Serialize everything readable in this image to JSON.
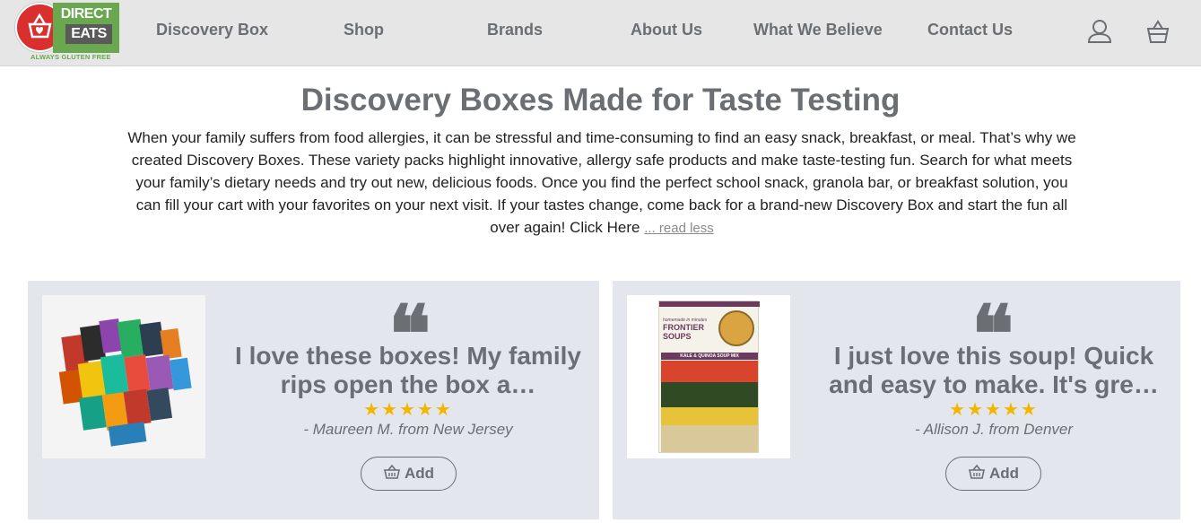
{
  "brand": {
    "name_line1": "DIRECT",
    "name_line2": "EATS",
    "tagline": "ALWAYS GLUTEN FREE"
  },
  "nav": {
    "items": [
      {
        "label": "Discovery Box"
      },
      {
        "label": "Shop"
      },
      {
        "label": "Brands"
      },
      {
        "label": "About Us"
      },
      {
        "label": "What We Believe"
      },
      {
        "label": "Contact Us"
      }
    ],
    "icons": [
      "user-icon",
      "basket-icon"
    ]
  },
  "hero": {
    "title": "Discovery Boxes Made for Taste Testing",
    "body": "When your family suffers from food allergies, it can be stressful and time-consuming to find an easy snack, breakfast, or meal. That’s why we created Discovery Boxes. These variety packs highlight innovative, allergy safe products and make taste-testing fun. Search for what meets your family’s dietary needs and try out new, delicious foods. Once you find the perfect school snack, granola bar, or breakfast solution, you can fill your cart with your favorites on your next visit. If your tastes change, come back for a brand-new Discovery Box and start the fun all over again! Click Here",
    "read_less": "... read less"
  },
  "testimonials": [
    {
      "quote_mark": "❝",
      "quote": "I love these boxes! My family rips open the box a…",
      "stars": "★★★★★",
      "rating": 5,
      "author": "- Maureen M. from New Jersey",
      "add_label": "Add"
    },
    {
      "quote_mark": "❝",
      "quote": "I just love this soup! Quick and easy to make. It's gre…",
      "stars": "★★★★★",
      "rating": 5,
      "author": "- Allison J. from Denver",
      "add_label": "Add",
      "product": {
        "brand": "FRONTIER SOUPS",
        "subtitle": "homemade in minutes",
        "flavor": "KALE & QUINOA SOUP MIX"
      }
    }
  ],
  "colors": {
    "header_bg": "#e6e6e6",
    "nav_text": "#6b6f73",
    "card_bg": "#e3e6ec",
    "star": "#f2b600",
    "brand_red": "#d9302f",
    "brand_green": "#6aa84f"
  }
}
